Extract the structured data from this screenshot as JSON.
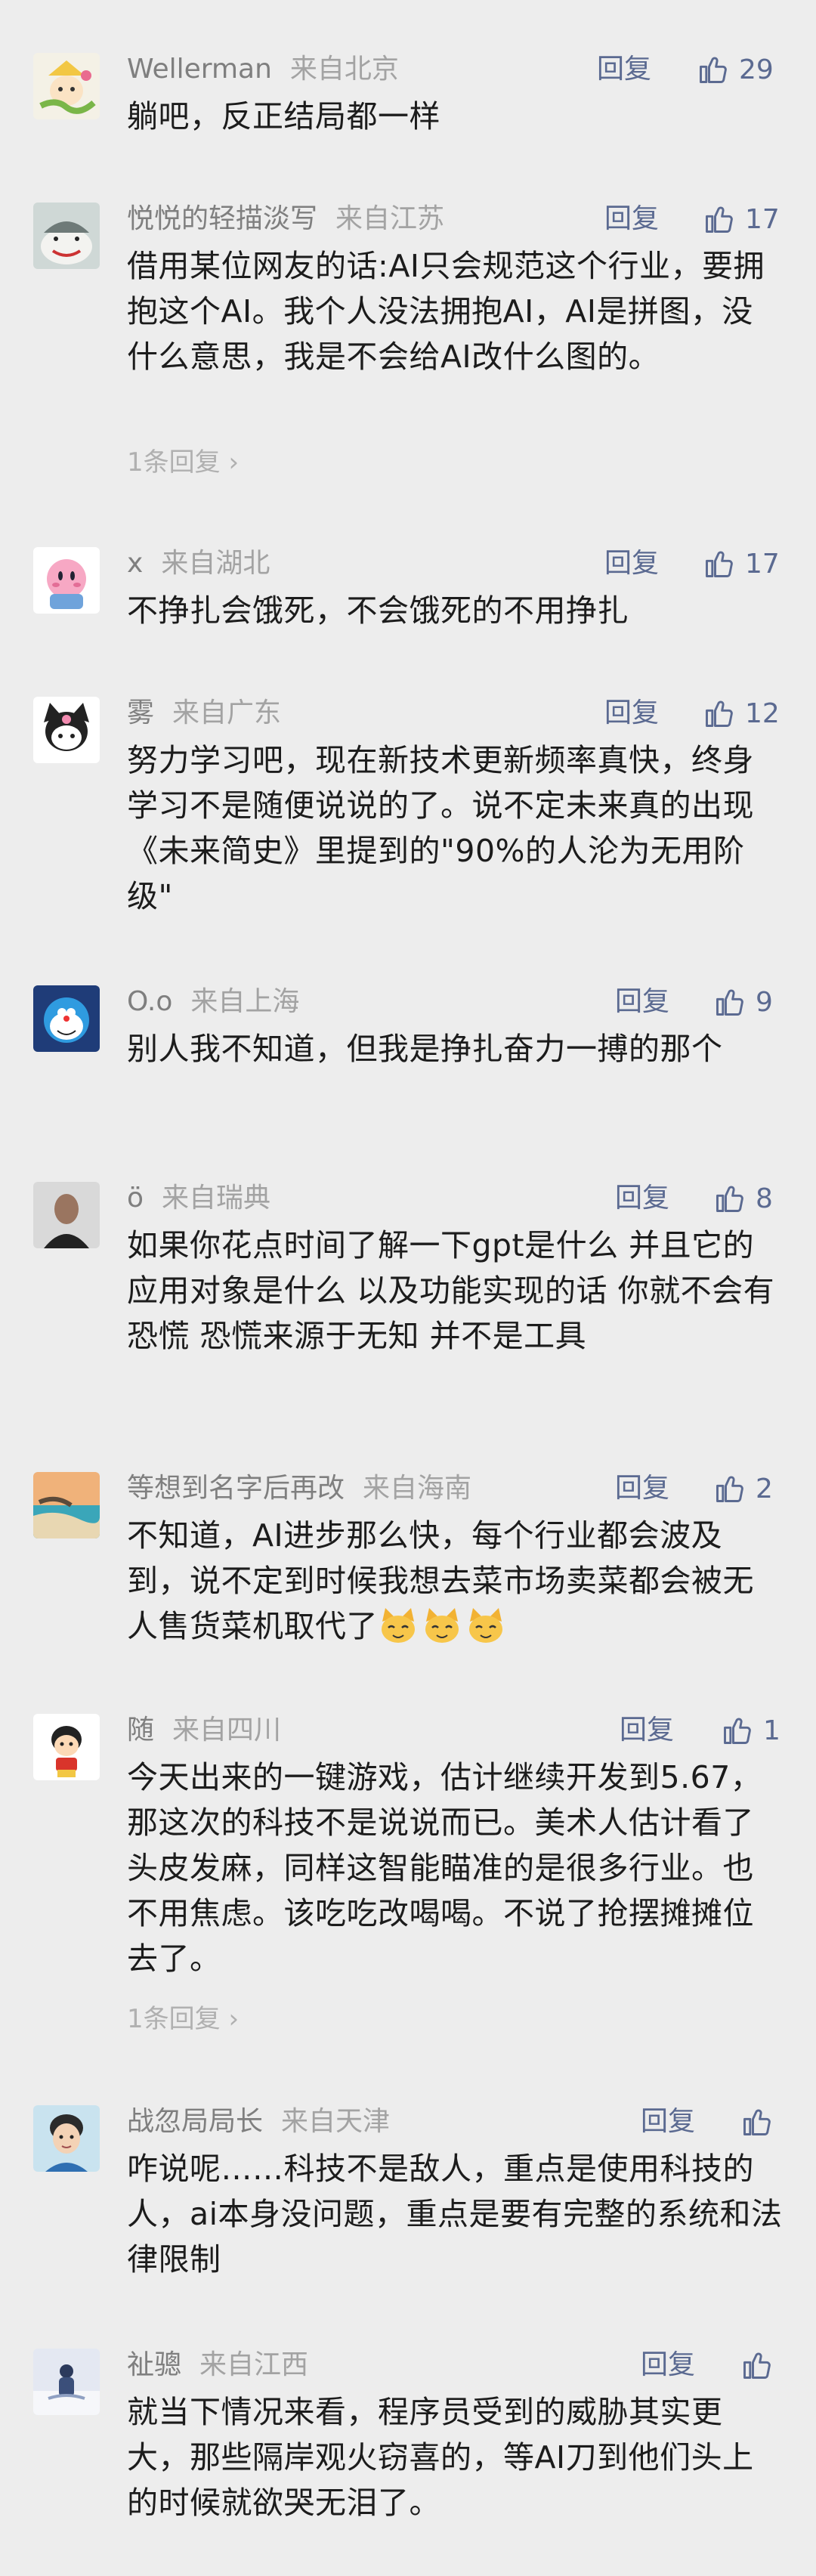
{
  "like_color": "#5b6a91",
  "comments": [
    {
      "name": "Wellerman",
      "location": "来自北京",
      "reply_label": "回复",
      "likes": "29",
      "text": "躺吧，反正结局都一样",
      "avatar_icon": "cartoon-character-avatar"
    },
    {
      "name": "悦悦的轻描淡写",
      "location": "来自江苏",
      "reply_label": "回复",
      "likes": "17",
      "text": "借用某位网友的话:AI只会规范这个行业，要拥抱这个AI。我个人没法拥抱AI，AI是拼图，没什么意思，我是不会给AI改什么图的。",
      "replies_label": "1条回复",
      "avatar_icon": "shark-avatar"
    },
    {
      "name": "x",
      "location": "来自湖北",
      "reply_label": "回复",
      "likes": "17",
      "text": "不挣扎会饿死，不会饿死的不用挣扎",
      "avatar_icon": "kirby-avatar"
    },
    {
      "name": "雾",
      "location": "来自广东",
      "reply_label": "回复",
      "likes": "12",
      "text": "努力学习吧，现在新技术更新频率真快，终身学习不是随便说说的了。说不定未来真的出现《未来简史》里提到的\"90%的人沦为无用阶级\"",
      "avatar_icon": "kuromi-avatar"
    },
    {
      "name": "O.o",
      "location": "来自上海",
      "reply_label": "回复",
      "likes": "9",
      "text": "别人我不知道，但我是挣扎奋力一搏的那个",
      "avatar_icon": "doraemon-avatar"
    },
    {
      "name": "ö",
      "location": "来自瑞典",
      "reply_label": "回复",
      "likes": "8",
      "text": "如果你花点时间了解一下gpt是什么 并且它的应用对象是什么 以及功能实现的话 你就不会有恐慌 恐慌来源于无知  并不是工具",
      "avatar_icon": "person-photo-avatar"
    },
    {
      "name": "等想到名字后再改",
      "location": "来自海南",
      "reply_label": "回复",
      "likes": "2",
      "text": "不知道，AI进步那么快，每个行业都会波及到，说不定到时候我想去菜市场卖菜都会被无人售货菜机取代了",
      "avatar_icon": "beach-landscape-avatar",
      "emoji_icon": "smirk-cat-emoji"
    },
    {
      "name": "随",
      "location": "来自四川",
      "reply_label": "回复",
      "likes": "1",
      "text": "今天出来的一键游戏，估计继续开发到5.67，那这次的科技不是说说而已。美术人估计看了头皮发麻，同样这智能瞄准的是很多行业。也不用焦虑。该吃吃改喝喝。不说了抢摆摊摊位去了。",
      "replies_label": "1条回复",
      "avatar_icon": "crayon-shin-chan-avatar"
    },
    {
      "name": "战忽局局长",
      "location": "来自天津",
      "reply_label": "回复",
      "likes": "",
      "text": "咋说呢……科技不是敌人，重点是使用科技的人，ai本身没问题，重点是要有完整的系统和法律限制",
      "avatar_icon": "boy-portrait-avatar"
    },
    {
      "name": "祉骢",
      "location": "来自江西",
      "reply_label": "回复",
      "likes": "",
      "text": "就当下情况来看，程序员受到的威胁其实更大，那些隔岸观火窃喜的，等AI刀到他们头上的时候就欲哭无泪了。",
      "avatar_icon": "snow-figure-avatar"
    }
  ]
}
